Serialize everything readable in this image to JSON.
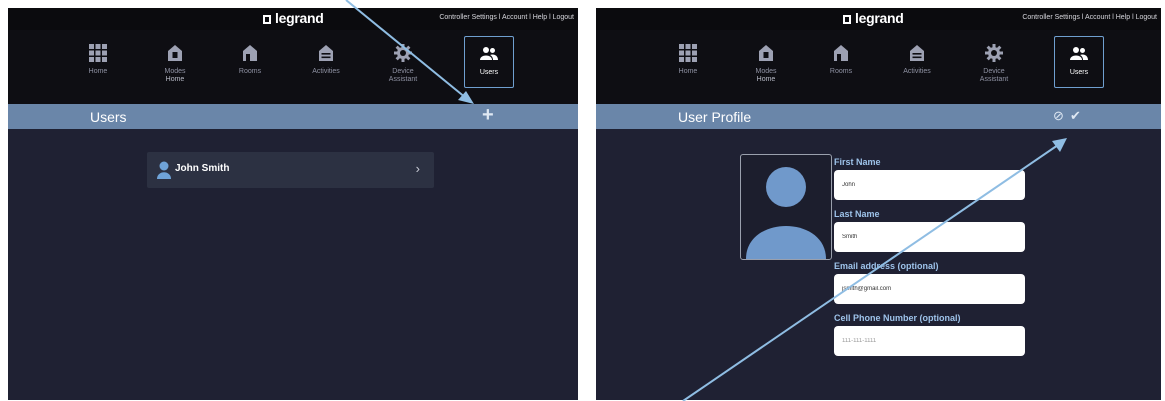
{
  "brand": {
    "logo": "legrand"
  },
  "top_links": {
    "controller_settings": "Controller Settings",
    "account": "Account",
    "help": "Help",
    "logout": "Logout",
    "separator": " l "
  },
  "nav": {
    "home": "Home",
    "modes": "Modes",
    "modes_sub": "Home",
    "rooms": "Rooms",
    "activities": "Activities",
    "device_assistant": "Device Assistant",
    "users": "Users"
  },
  "left_panel": {
    "title": "Users",
    "add_symbol": "+",
    "users": [
      {
        "name": "John Smith",
        "chevron": "›"
      }
    ]
  },
  "right_panel": {
    "title": "User Profile",
    "cancel_symbol": "⊘",
    "save_symbol": "✔",
    "fields": {
      "first_name_label": "First Name",
      "first_name_value": "John",
      "last_name_label": "Last Name",
      "last_name_value": "Smith",
      "email_label": "Email address (optional)",
      "email_value": "jsmith@gmail.com",
      "phone_label": "Cell Phone Number (optional)",
      "phone_placeholder": "111-111-1111"
    }
  },
  "colors": {
    "background": "#1f2133",
    "title_bar": "#6a86a9",
    "accent": "#6f9fd0",
    "annotation_arrow": "#8fbde3"
  }
}
